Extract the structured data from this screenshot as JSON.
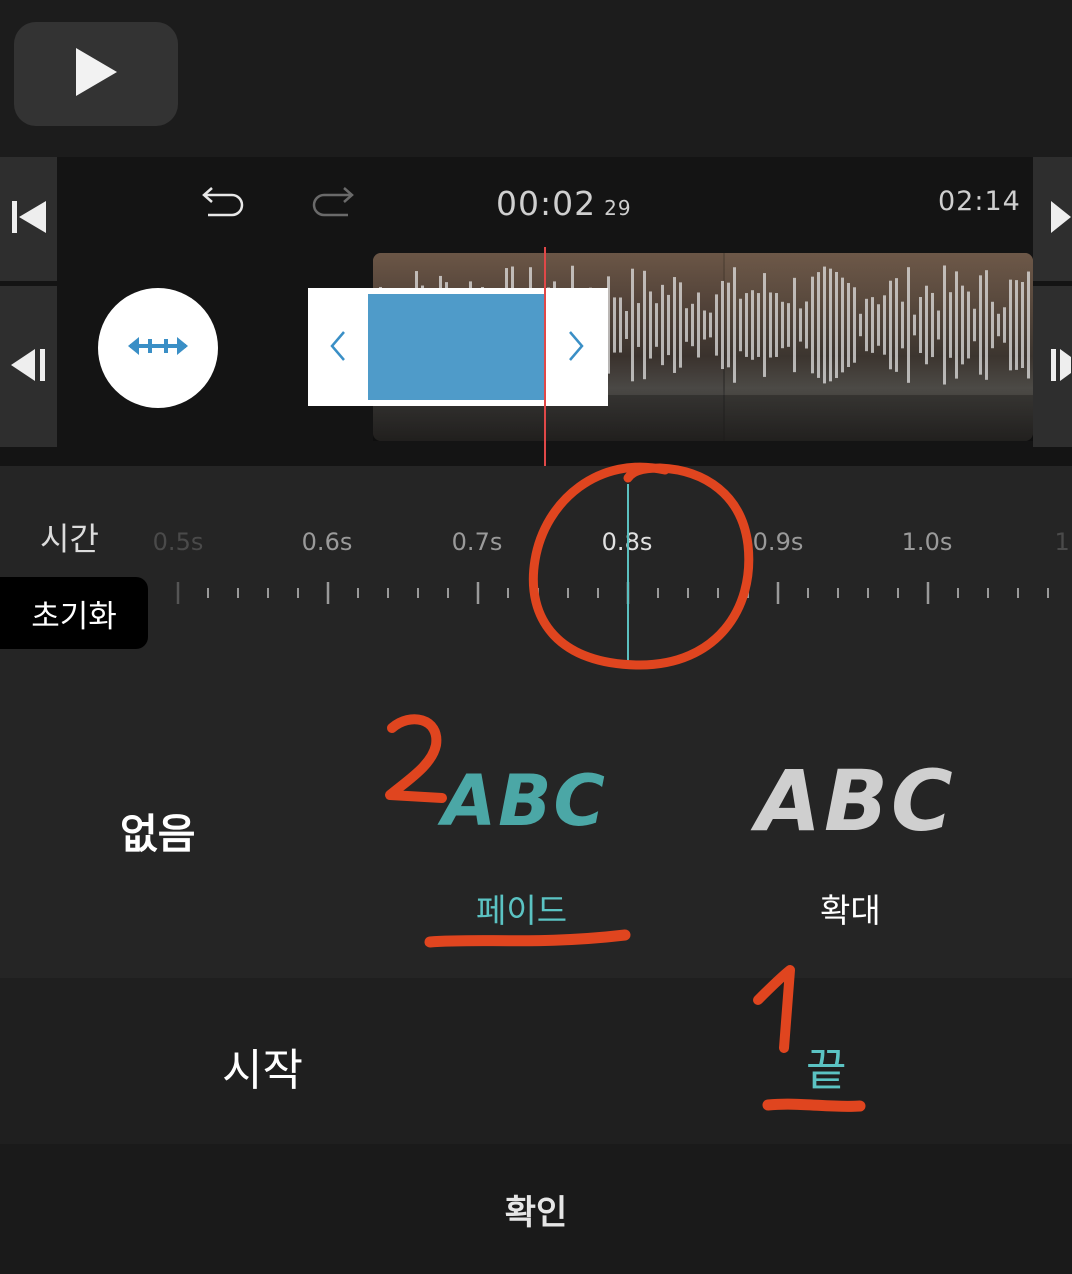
{
  "toolbar": {
    "play_icon": "play-icon",
    "undo_icon": "undo-icon",
    "redo_icon": "redo-icon"
  },
  "timeline": {
    "timecode": "00:02",
    "timecode_frames": "29",
    "duration": "02:14",
    "resize_icon": "horizontal-resize-icon"
  },
  "transition": {
    "time_label": "시간",
    "reset_label": "초기화",
    "ticks": [
      "0.5s",
      "0.6s",
      "0.7s",
      "0.8s",
      "0.9s",
      "1.0s",
      "1."
    ],
    "selected_tick": "0.8s"
  },
  "effects": {
    "none_label": "없음",
    "fade_preview": "ABC",
    "fade_label": "페이드",
    "zoom_preview": "ABC",
    "zoom_label": "확대",
    "selected": "페이드"
  },
  "tabs": {
    "start_label": "시작",
    "end_label": "끝",
    "selected": "끝"
  },
  "confirm_label": "확인",
  "annotations": {
    "number_1": "1",
    "number_2": "2",
    "color": "#e0451f"
  },
  "colors": {
    "accent": "#5bc3c3",
    "playhead": "#e04848",
    "selection": "#4f9bc9"
  }
}
